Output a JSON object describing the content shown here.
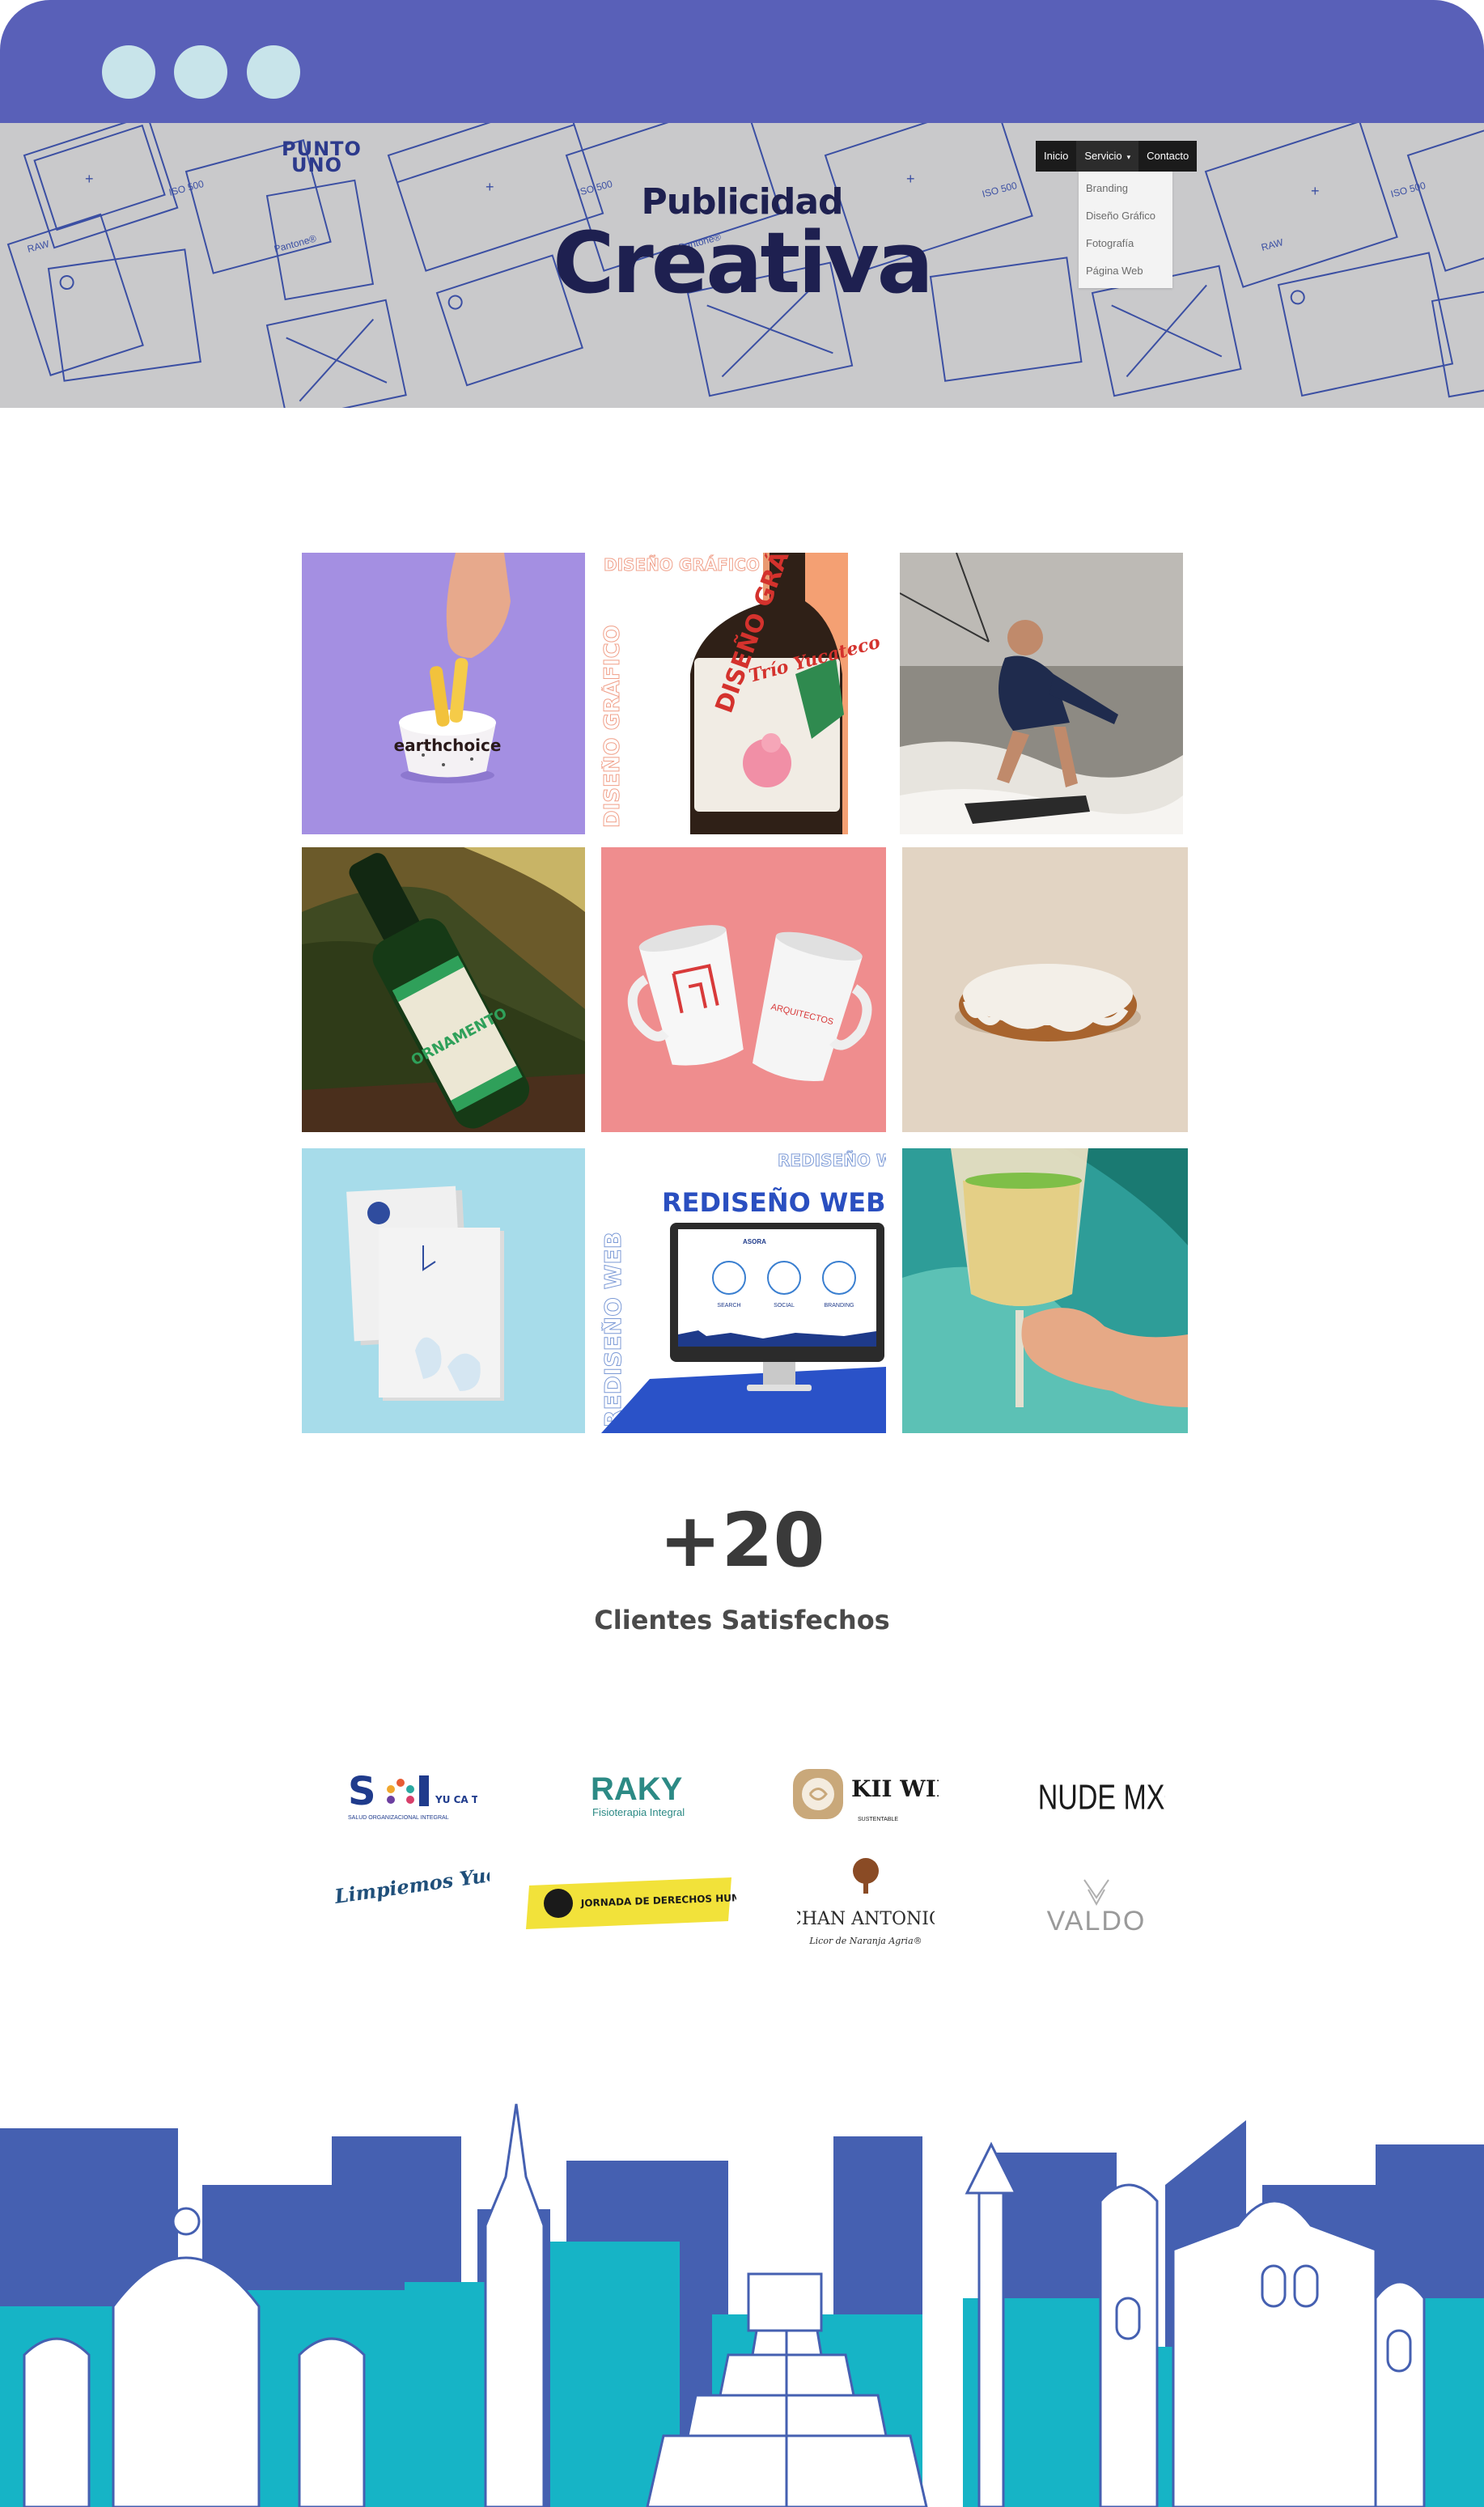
{
  "window": {
    "controls": [
      "dot",
      "dot",
      "dot"
    ]
  },
  "brand": {
    "logo_line1": "PUNTO",
    "logo_line2": "UNO"
  },
  "hero": {
    "subtitle": "Publicidad",
    "title": "Creativa",
    "pattern_labels": [
      "Pantone®",
      "ISO 500",
      "RAW"
    ]
  },
  "nav": {
    "items": [
      {
        "label": "Inicio"
      },
      {
        "label": "Servicio",
        "has_dropdown": true
      },
      {
        "label": "Contacto"
      }
    ],
    "dropdown": [
      "Branding",
      "Diseño Gráfico",
      "Fotografía",
      "Página Web"
    ]
  },
  "gallery": {
    "tiles": [
      {
        "name": "earthchoice-dip",
        "brand": "earthchoice"
      },
      {
        "name": "trio-yucateco-beer",
        "header": "DISEÑO GRÁFICO",
        "title": "DISEÑO GRÁFICO",
        "side": "DISEÑO GRÁFICO",
        "label": "Trío Yucateco"
      },
      {
        "name": "kitesurfer"
      },
      {
        "name": "green-bottle",
        "label": "ORNAMENTO"
      },
      {
        "name": "red-mugs",
        "label": "ARQUITECTOS"
      },
      {
        "name": "pastry"
      },
      {
        "name": "stationery"
      },
      {
        "name": "web-redesign",
        "header": "REDISEÑO WEB",
        "title": "REDISEÑO WEB",
        "side": "REDISEÑO WEB",
        "screen_label": "ASORA",
        "columns": [
          "SEARCH",
          "SOCIAL",
          "BRANDING"
        ]
      },
      {
        "name": "wine-glass"
      }
    ]
  },
  "stats": {
    "value": "+20",
    "label": "Clientes Satisfechos"
  },
  "clients": [
    {
      "name": "SOL YUCATÁN",
      "text": "S",
      "small_text": "YU CA TÁN",
      "tagline": "SALUD ORGANIZACIONAL INTEGRAL",
      "color": "#1f3b8c"
    },
    {
      "name": "RAKY",
      "text": "RAKY",
      "tagline": "Fisioterapia Integral",
      "color": "#2c8a85"
    },
    {
      "name": "KIIWIK",
      "text": "KII WIK",
      "tagline": "SUSTENTABLE",
      "color": "#1a1a1a"
    },
    {
      "name": "NUDE MX",
      "text": "NUDE MX®",
      "color": "#1a1a1a"
    },
    {
      "name": "Limpiemos Yucatán",
      "text": "Limpiemos Yucatán",
      "color": "#1f4f7a"
    },
    {
      "name": "Jornada de Derechos Humanos",
      "text": "JORNADA DE DERECHOS HUMANOS AC",
      "color": "#f2e23a"
    },
    {
      "name": "Chan Antonio",
      "text": "CHAN ANTONIO",
      "tagline": "Licor de Naranja Agria®",
      "color": "#2b2b2b"
    },
    {
      "name": "VALDO",
      "text": "VALDO",
      "color": "#8a8a8a"
    }
  ],
  "colors": {
    "topbar": "#5960b8",
    "hero_bg": "#c9c9cb",
    "navy": "#1e2050",
    "skyline_blue": "#4560b1",
    "skyline_teal": "#16b4c6"
  }
}
